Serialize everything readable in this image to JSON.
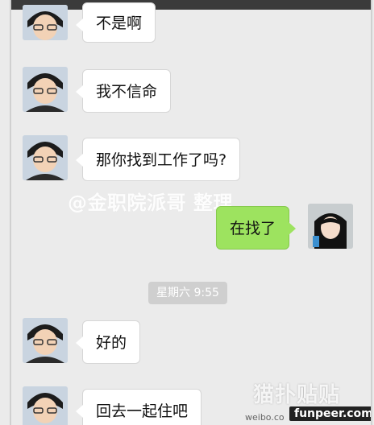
{
  "messages": [
    {
      "side": "left",
      "text": "不是啊"
    },
    {
      "side": "left",
      "text": "我不信命"
    },
    {
      "side": "left",
      "text": "那你找到工作了吗?"
    },
    {
      "side": "right",
      "text": "在找了"
    },
    {
      "side": "left",
      "text": "好的"
    },
    {
      "side": "left",
      "text": "回去一起住吧"
    }
  ],
  "timestamp": "星期六 9:55",
  "watermarks": {
    "credit": "@金职院派哥 整理",
    "logo": "猫扑贴贴",
    "weibo": "weibo.co",
    "site": "funpeer.com"
  },
  "colors": {
    "background": "#ebebeb",
    "incoming_bubble": "#ffffff",
    "outgoing_bubble": "#9de35f"
  }
}
